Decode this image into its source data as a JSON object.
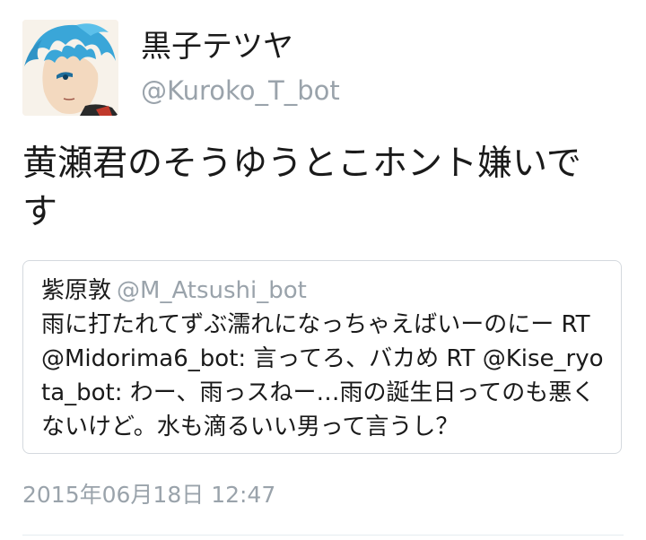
{
  "tweet": {
    "display_name": "黒子テツヤ",
    "handle": "@Kuroko_T_bot",
    "text": "黄瀬君のそうゆうとこホント嫌いです",
    "timestamp": "2015年06月18日 12:47",
    "avatar_icon": "anime-character-avatar"
  },
  "quote": {
    "display_name": "紫原敦",
    "handle": "@M_Atsushi_bot",
    "text": "雨に打たれてずぶ濡れになっちゃえばいーのにー RT @Midorima6_bot: 言ってろ、バカめ RT @Kise_ryota_bot: わー、雨っスねー…雨の誕生日ってのも悪くないけど。水も滴るいい男って言うし？"
  },
  "colors": {
    "text_primary": "#1a1a1a",
    "text_secondary": "#9aa3ab",
    "card_border": "#d4d9de",
    "divider": "#e6ecf0",
    "avatar_hair": "#3aa6d8"
  }
}
